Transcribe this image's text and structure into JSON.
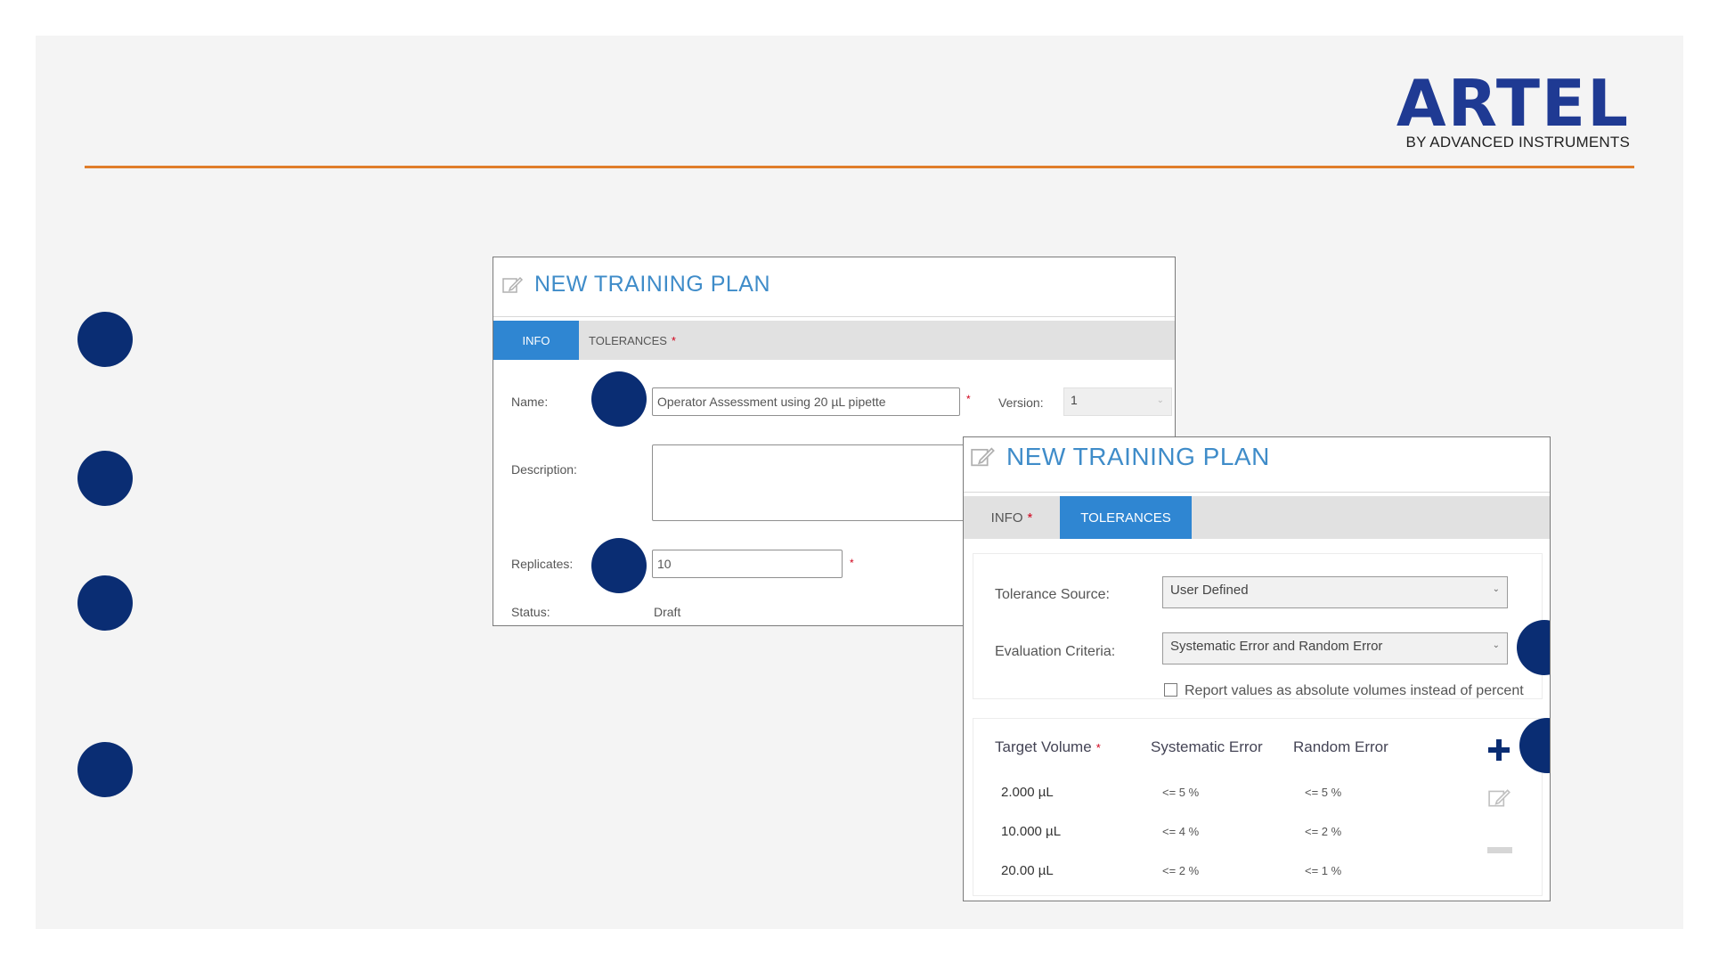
{
  "brand": {
    "name": "ARTEL",
    "tagline": "BY ADVANCED INSTRUMENTS",
    "accent": "#1f3a93",
    "rule_color": "#e07e2b"
  },
  "info_panel": {
    "title": "NEW TRAINING PLAN",
    "tabs": [
      {
        "label": "INFO",
        "active": true
      },
      {
        "label": "TOLERANCES",
        "active": false,
        "required": "*"
      }
    ],
    "name_label": "Name:",
    "name_value": "Operator Assessment using 20 µL pipette",
    "version_label": "Version:",
    "version_value": "1",
    "description_label": "Description:",
    "description_value": "",
    "replicates_label": "Replicates:",
    "replicates_value": "10",
    "status_label": "Status:",
    "status_value": "Draft",
    "required_mark": "*"
  },
  "tolerances_panel": {
    "title": "NEW TRAINING PLAN",
    "tabs": [
      {
        "label": "INFO",
        "required": "*",
        "active": false
      },
      {
        "label": "TOLERANCES",
        "active": true
      }
    ],
    "tolerance_source_label": "Tolerance Source:",
    "tolerance_source_value": "User Defined",
    "evaluation_criteria_label": "Evaluation Criteria:",
    "evaluation_criteria_value": "Systematic Error and Random Error",
    "report_absolute_label": "Report values as absolute volumes instead of percent",
    "report_absolute_checked": false,
    "table": {
      "headers": {
        "target_volume": "Target Volume",
        "systematic_error": "Systematic Error",
        "random_error": "Random Error"
      },
      "required_mark": "*",
      "rows": [
        {
          "target_volume": "2.000 µL",
          "systematic_error": "<= 5 %",
          "random_error": "<= 5 %"
        },
        {
          "target_volume": "10.000 µL",
          "systematic_error": "<= 4 %",
          "random_error": "<= 2 %"
        },
        {
          "target_volume": "20.00 µL",
          "systematic_error": "<= 2 %",
          "random_error": "<= 1 %"
        }
      ]
    },
    "icons": [
      "plus-icon",
      "edit-icon",
      "minus-icon"
    ]
  },
  "colors": {
    "bullet": "#0a2d73",
    "tab_active": "#2f86d2",
    "title_blue": "#3f8cc9",
    "required": "#d0021b"
  }
}
